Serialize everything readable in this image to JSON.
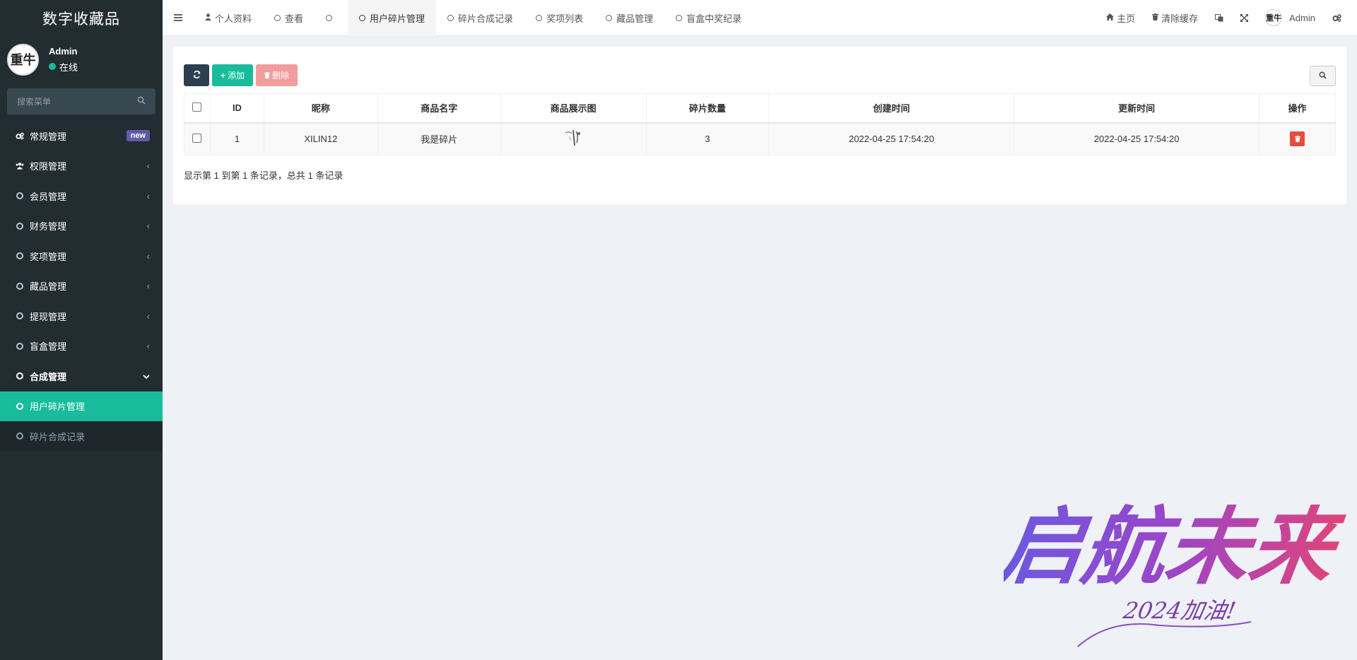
{
  "sidebar": {
    "brand": "数字收藏品",
    "user": {
      "name": "Admin",
      "status": "在线",
      "avatar_text": "重牛"
    },
    "search_placeholder": "搜索菜单",
    "items": [
      {
        "label": "常规管理",
        "icon": "cogs-icon",
        "badge": "new"
      },
      {
        "label": "权限管理",
        "icon": "users-icon"
      },
      {
        "label": "会员管理",
        "icon": "circle-icon"
      },
      {
        "label": "财务管理",
        "icon": "circle-icon"
      },
      {
        "label": "奖项管理",
        "icon": "circle-icon"
      },
      {
        "label": "藏品管理",
        "icon": "circle-icon"
      },
      {
        "label": "提现管理",
        "icon": "circle-icon"
      },
      {
        "label": "盲盒管理",
        "icon": "circle-icon"
      },
      {
        "label": "合成管理",
        "icon": "circle-icon"
      },
      {
        "label": "用户碎片管理",
        "icon": "circle-icon"
      },
      {
        "label": "碎片合成记录",
        "icon": "circle-icon"
      }
    ]
  },
  "topbar": {
    "tabs": [
      {
        "label": "个人资料",
        "icon": "user-icon"
      },
      {
        "label": "查看",
        "icon": "circle-icon"
      },
      {
        "label": "",
        "icon": "circle-icon"
      },
      {
        "label": "用户碎片管理",
        "icon": "circle-icon"
      },
      {
        "label": "碎片合成记录",
        "icon": "circle-icon"
      },
      {
        "label": "奖项列表",
        "icon": "circle-icon"
      },
      {
        "label": "藏品管理",
        "icon": "circle-icon"
      },
      {
        "label": "盲盒中奖纪录",
        "icon": "circle-icon"
      }
    ],
    "right": {
      "home": "主页",
      "clear_cache": "清除缓存",
      "admin": "Admin",
      "avatar_text": "重牛"
    }
  },
  "toolbar": {
    "add": "添加",
    "delete": "删除"
  },
  "table": {
    "headers": [
      "ID",
      "昵称",
      "商品名字",
      "商品展示图",
      "碎片数量",
      "创建时间",
      "更新时间",
      "操作"
    ],
    "rows": [
      {
        "id": "1",
        "nickname": "XILIN12",
        "product_name": "我是碎片",
        "fragments": "3",
        "created": "2022-04-25 17:54:20",
        "updated": "2022-04-25 17:54:20"
      }
    ]
  },
  "pager_info": "显示第 1 到第 1 条记录，总共 1 条记录",
  "watermark": {
    "main": "启航未来",
    "sub": "2024加油!"
  },
  "colors": {
    "sidebar": "#222d32",
    "accent": "#18bc9c",
    "danger": "#e74c3c",
    "badge": "#605ca8"
  }
}
